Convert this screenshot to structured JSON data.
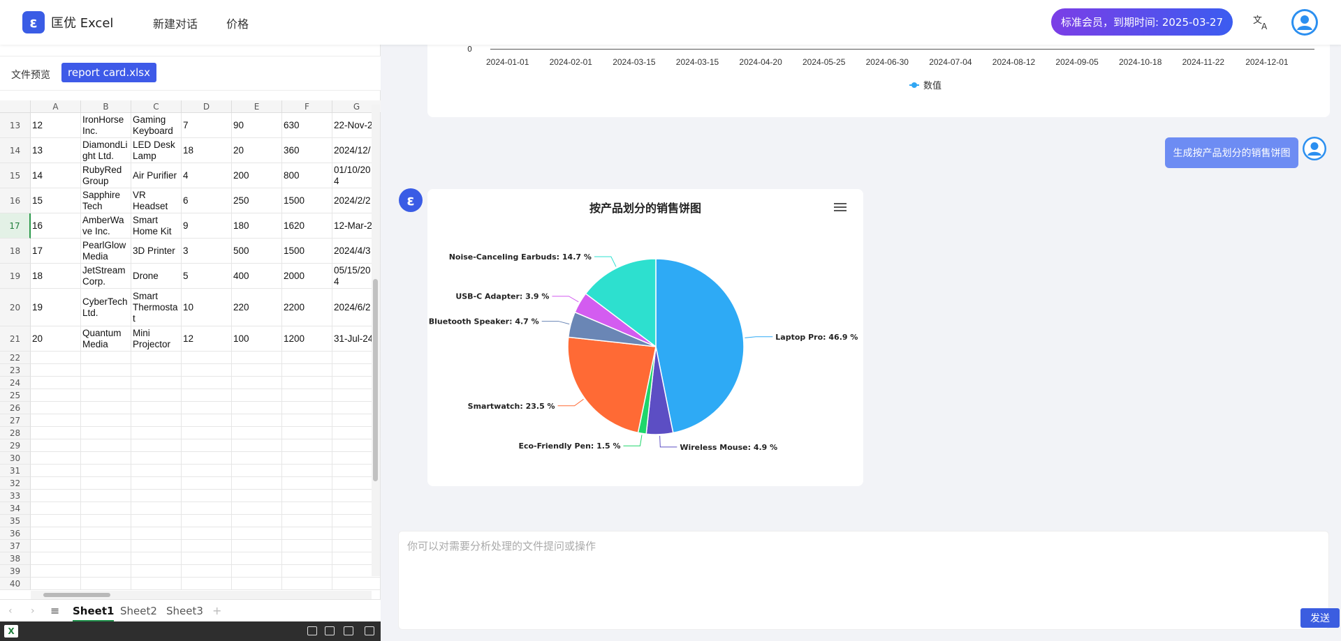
{
  "header": {
    "logo_letter": "ε",
    "app_title": "匡优 Excel",
    "nav": [
      "新建对话",
      "价格"
    ],
    "membership": "标准会员，到期时间: 2025-03-27"
  },
  "preview": {
    "label": "文件预览",
    "file_name": "report card.xlsx"
  },
  "sheet": {
    "columns": [
      "A",
      "B",
      "C",
      "D",
      "E",
      "F",
      "G"
    ],
    "rows": [
      {
        "num": "13",
        "cells": [
          "12",
          "IronHorse\nInc.",
          "Gaming\nKeyboard",
          "7",
          "90",
          "630",
          "22-Nov-2"
        ]
      },
      {
        "num": "14",
        "cells": [
          "13",
          "DiamondLi\nght Ltd.",
          "LED Desk\nLamp",
          "18",
          "20",
          "360",
          "2024/12/"
        ]
      },
      {
        "num": "15",
        "cells": [
          "14",
          "RubyRed\nGroup",
          "Air Purifier",
          "4",
          "200",
          "800",
          "01/10/20\n4"
        ]
      },
      {
        "num": "16",
        "cells": [
          "15",
          "Sapphire\nTech",
          "VR\nHeadset",
          "6",
          "250",
          "1500",
          "2024/2/2"
        ]
      },
      {
        "num": "17",
        "cells": [
          "16",
          "AmberWa\nve Inc.",
          "Smart\nHome Kit",
          "9",
          "180",
          "1620",
          "12-Mar-2"
        ]
      },
      {
        "num": "18",
        "cells": [
          "17",
          "PearlGlow\nMedia",
          "3D Printer",
          "3",
          "500",
          "1500",
          "2024/4/3"
        ]
      },
      {
        "num": "19",
        "cells": [
          "18",
          "JetStream\nCorp.",
          "Drone",
          "5",
          "400",
          "2000",
          "05/15/20\n4"
        ]
      },
      {
        "num": "20",
        "cells": [
          "19",
          "CyberTech\nLtd.",
          "Smart\nThermosta\nt",
          "10",
          "220",
          "2200",
          "2024/6/2"
        ]
      },
      {
        "num": "21",
        "cells": [
          "20",
          "Quantum\nMedia",
          "Mini\nProjector",
          "12",
          "100",
          "1200",
          "31-Jul-24"
        ]
      }
    ],
    "empty_rows": [
      "22",
      "23",
      "24",
      "25",
      "26",
      "27",
      "28",
      "29",
      "30",
      "31",
      "32",
      "33",
      "34",
      "35",
      "36",
      "37",
      "38",
      "39",
      "40"
    ],
    "selected_row": "17",
    "tabs": [
      "Sheet1",
      "Sheet2",
      "Sheet3"
    ],
    "active_tab": "Sheet1"
  },
  "line_chart_tail": {
    "y_zero": "0",
    "x_ticks": [
      "2024-01-01",
      "2024-02-01",
      "2024-03-15",
      "2024-03-15",
      "2024-04-20",
      "2024-05-25",
      "2024-06-30",
      "2024-07-04",
      "2024-08-12",
      "2024-09-05",
      "2024-10-18",
      "2024-11-22",
      "2024-12-01"
    ],
    "legend": "数值"
  },
  "chat": {
    "user_message": "生成按产品划分的销售饼图",
    "input_placeholder": "你可以对需要分析处理的文件提问或操作",
    "send_label": "发送"
  },
  "chart_data": {
    "type": "pie",
    "title": "按产品划分的销售饼图",
    "slices": [
      {
        "name": "Laptop Pro",
        "value": 46.9,
        "label": "Laptop Pro: 46.9 %",
        "color": "#2eaaf5"
      },
      {
        "name": "Wireless Mouse",
        "value": 4.9,
        "label": "Wireless Mouse: 4.9 %",
        "color": "#5c4ec4"
      },
      {
        "name": "Eco-Friendly Pen",
        "value": 1.5,
        "label": "Eco-Friendly Pen: 1.5 %",
        "color": "#1ed66b"
      },
      {
        "name": "Smartwatch",
        "value": 23.5,
        "label": "Smartwatch: 23.5 %",
        "color": "#ff6a35"
      },
      {
        "name": "Bluetooth Speaker",
        "value": 4.7,
        "label": "Bluetooth Speaker: 4.7 %",
        "color": "#6a86b5"
      },
      {
        "name": "USB-C Adapter",
        "value": 3.9,
        "label": "USB-C Adapter: 3.9 %",
        "color": "#d35cf0"
      },
      {
        "name": "Noise-Canceling Earbuds",
        "value": 14.7,
        "label": "Noise-Canceling Earbuds: 14.7 %",
        "color": "#2de0cf"
      }
    ]
  }
}
